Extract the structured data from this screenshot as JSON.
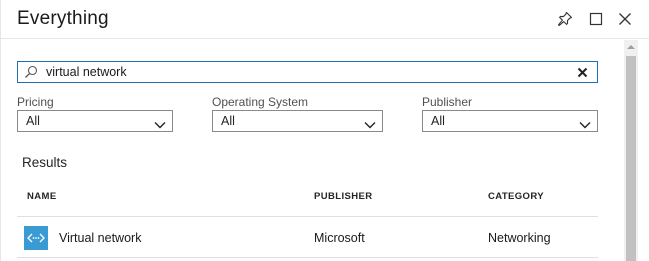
{
  "blade": {
    "title": "Everything"
  },
  "search": {
    "value": "virtual network",
    "placeholder": ""
  },
  "filters": [
    {
      "label": "Pricing",
      "value": "All"
    },
    {
      "label": "Operating System",
      "value": "All"
    },
    {
      "label": "Publisher",
      "value": "All"
    }
  ],
  "results": {
    "title": "Results",
    "columns": [
      "NAME",
      "PUBLISHER",
      "CATEGORY"
    ],
    "rows": [
      {
        "name": "Virtual network",
        "publisher": "Microsoft",
        "category": "Networking",
        "icon": "virtual-network-icon"
      }
    ]
  },
  "icons": {
    "pin": "pin-icon",
    "maximize": "maximize-icon",
    "close": "close-icon",
    "search": "search-icon",
    "clear": "clear-icon",
    "chevron": "chevron-down-icon"
  },
  "colors": {
    "accent": "#1f6fb2",
    "row_icon_bg": "#3a9bd4"
  }
}
